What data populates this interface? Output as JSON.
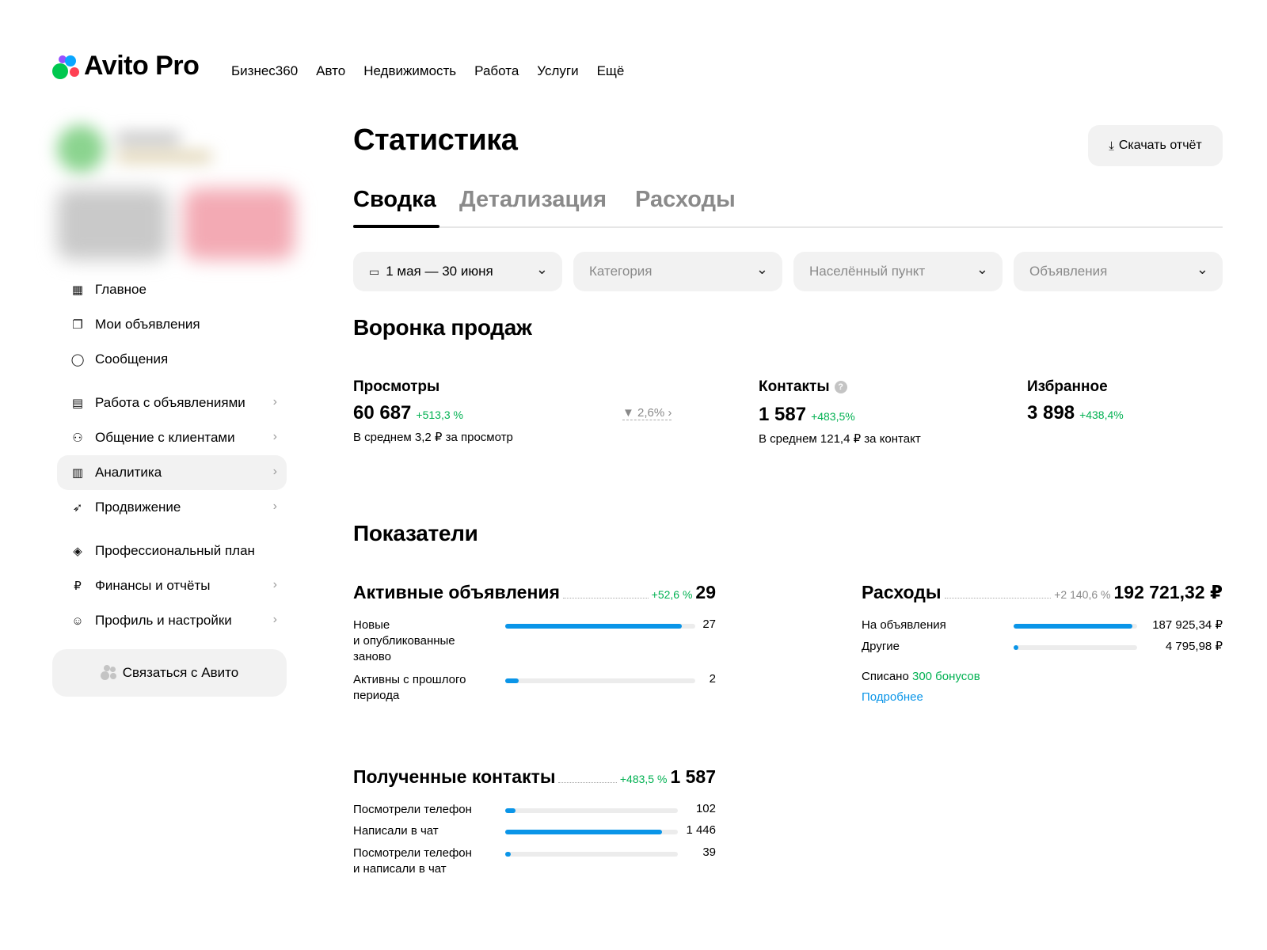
{
  "header": {
    "logo_text": "Avito Pro",
    "nav": [
      "Бизнес360",
      "Авто",
      "Недвижимость",
      "Работа",
      "Услуги",
      "Ещё"
    ]
  },
  "sidebar": {
    "menu": [
      {
        "label": "Главное",
        "icon": "grid-icon",
        "chevron": false,
        "active": false
      },
      {
        "label": "Мои объявления",
        "icon": "copy-icon",
        "chevron": false,
        "active": false
      },
      {
        "label": "Сообщения",
        "icon": "chat-bubble-icon",
        "chevron": false,
        "active": false
      },
      {
        "label": "Работа с объявлениями",
        "icon": "calendar-list-icon",
        "chevron": true,
        "active": false
      },
      {
        "label": "Общение с клиентами",
        "icon": "users-icon",
        "chevron": true,
        "active": false
      },
      {
        "label": "Аналитика",
        "icon": "bar-chart-icon",
        "chevron": true,
        "active": true
      },
      {
        "label": "Продвижение",
        "icon": "rocket-icon",
        "chevron": true,
        "active": false
      },
      {
        "label": "Профессиональный план",
        "icon": "diamond-icon",
        "chevron": false,
        "active": false
      },
      {
        "label": "Финансы и отчёты",
        "icon": "ruble-icon",
        "chevron": true,
        "active": false
      },
      {
        "label": "Профиль и настройки",
        "icon": "profile-circle-icon",
        "chevron": true,
        "active": false
      }
    ],
    "contact_button": "Связаться с Авито"
  },
  "main": {
    "title": "Статистика",
    "download_button": "Скачать отчёт",
    "tabs": [
      "Сводка",
      "Детализация",
      "Расходы"
    ],
    "active_tab": 0,
    "filters": {
      "date": "1 мая — 30 июня",
      "category_placeholder": "Категория",
      "city_placeholder": "Населённый пункт",
      "ads_placeholder": "Объявления"
    },
    "funnel": {
      "title": "Воронка продаж",
      "views": {
        "label": "Просмотры",
        "value": "60 687",
        "change": "+513,3 %",
        "sub": "В среднем 3,2 ₽ за просмотр"
      },
      "conversion": "2,6%",
      "contacts": {
        "label": "Контакты",
        "value": "1 587",
        "change": "+483,5%",
        "sub": "В среднем 121,4 ₽ за контакт"
      },
      "favorites": {
        "label": "Избранное",
        "value": "3 898",
        "change": "+438,4%"
      }
    },
    "indicators": {
      "title": "Показатели",
      "active_ads": {
        "title": "Активные объявления",
        "change": "+52,6 %",
        "value": "29",
        "rows": [
          {
            "label_lines": [
              "Новые",
              "и опубликованные",
              "заново"
            ],
            "value": "27",
            "fill": 0.93
          },
          {
            "label_lines": [
              "Активны с прошлого",
              "периода"
            ],
            "value": "2",
            "fill": 0.07
          }
        ]
      },
      "expenses": {
        "title": "Расходы",
        "change": "+2 140,6 %",
        "value": "192 721,32 ₽",
        "rows": [
          {
            "label": "На объявления",
            "value": "187 925,34 ₽",
            "fill": 0.96
          },
          {
            "label": "Другие",
            "value": "4 795,98 ₽",
            "fill": 0.04
          }
        ],
        "written_off_prefix": "Списано",
        "written_off_bonus": "300 бонусов",
        "more_link": "Подробнее"
      },
      "contacts": {
        "title": "Полученные контакты",
        "change": "+483,5 %",
        "value": "1 587",
        "rows": [
          {
            "label_lines": [
              "Посмотрели телефон"
            ],
            "value": "102",
            "fill": 0.06
          },
          {
            "label_lines": [
              "Написали в чат"
            ],
            "value": "1 446",
            "fill": 0.91
          },
          {
            "label_lines": [
              "Посмотрели телефон",
              "и написали в чат"
            ],
            "value": "39",
            "fill": 0.03
          }
        ]
      }
    }
  },
  "colors": {
    "accent_blue": "#0a95e8",
    "positive_green": "#02b152",
    "surface_grey": "#f2f2f2"
  }
}
